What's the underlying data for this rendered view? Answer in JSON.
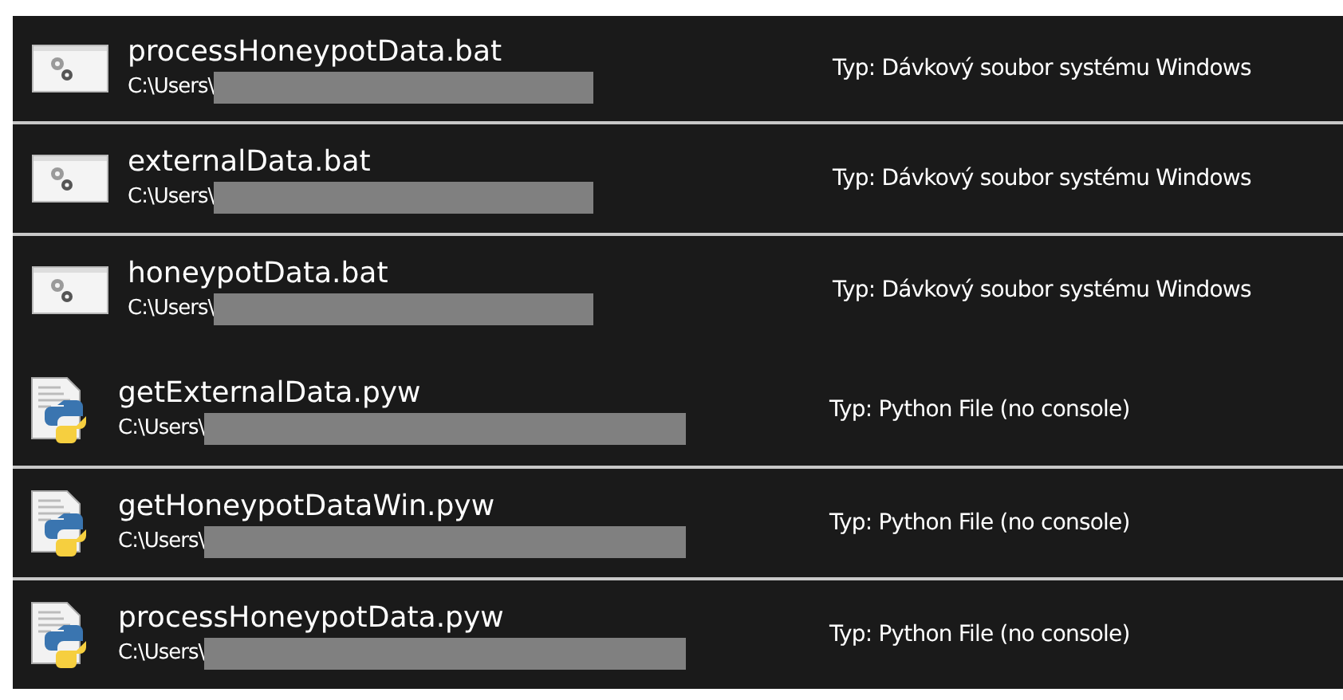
{
  "groups": [
    {
      "kind": "bat",
      "rows": [
        {
          "name": "processHoneypotData.bat",
          "path": "C:\\Users\\",
          "type": "Typ: Dávkový soubor systému Windows"
        },
        {
          "name": "externalData.bat",
          "path": "C:\\Users\\",
          "type": "Typ: Dávkový soubor systému Windows"
        },
        {
          "name": "honeypotData.bat",
          "path": "C:\\Users\\",
          "type": "Typ: Dávkový soubor systému Windows"
        }
      ]
    },
    {
      "kind": "pyw",
      "rows": [
        {
          "name": "getExternalData.pyw",
          "path": "C:\\Users\\",
          "type": "Typ: Python File (no console)"
        },
        {
          "name": "getHoneypotDataWin.pyw",
          "path": "C:\\Users\\",
          "type": "Typ: Python File (no console)"
        },
        {
          "name": "processHoneypotData.pyw",
          "path": "C:\\Users\\",
          "type": "Typ: Python File (no console)"
        }
      ]
    }
  ]
}
